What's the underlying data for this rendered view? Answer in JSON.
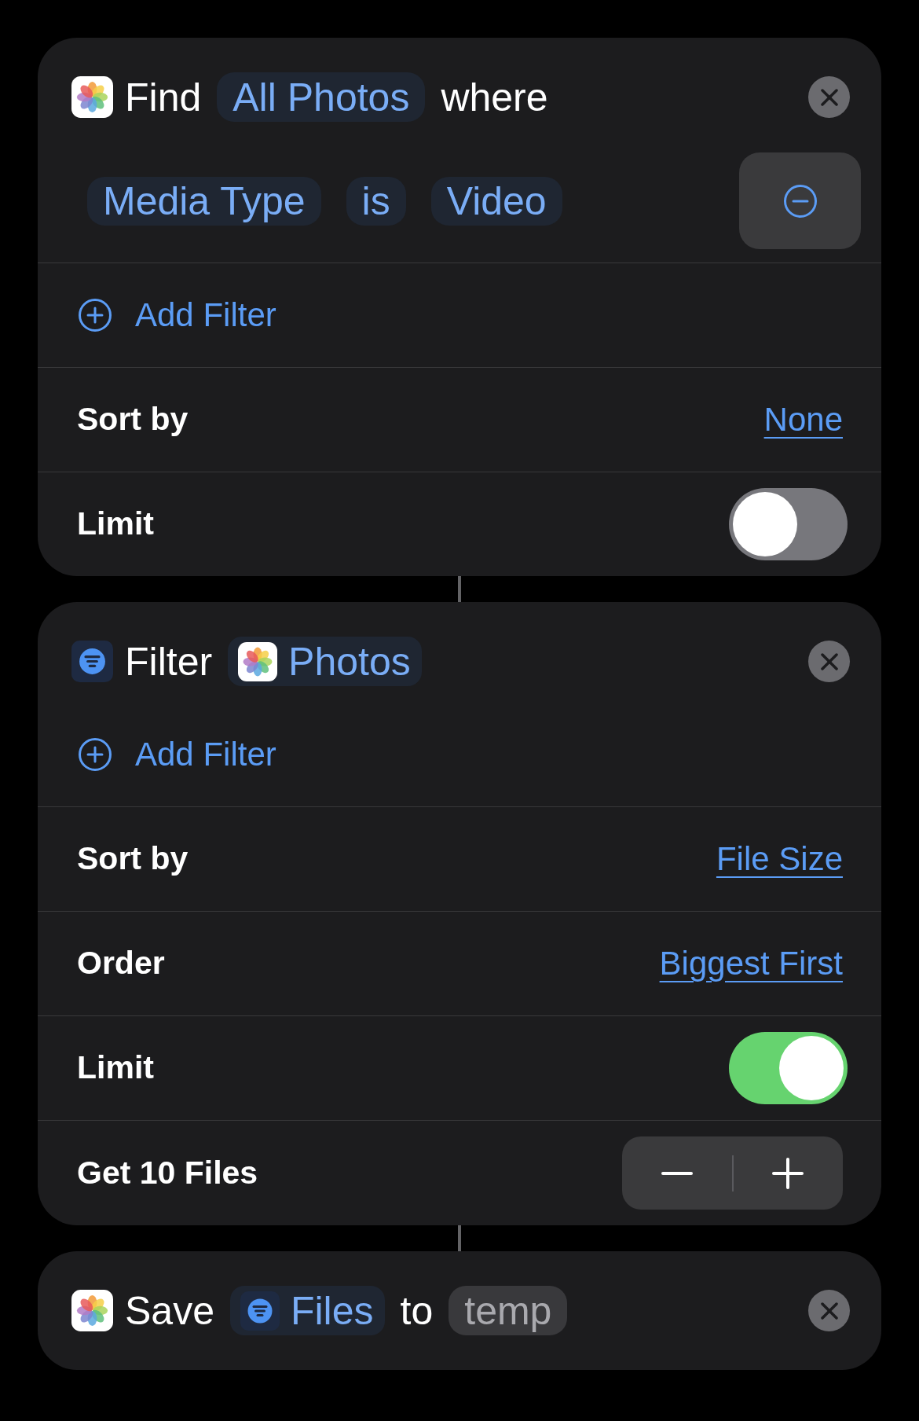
{
  "actions": [
    {
      "kind": "photos",
      "header": [
        {
          "kind": "text",
          "text": "Find"
        },
        {
          "kind": "parameter",
          "text": "All Photos"
        },
        {
          "kind": "text",
          "text": "where"
        }
      ],
      "filters": [
        {
          "tokens": [
            "Media Type",
            "is",
            "Video"
          ]
        }
      ],
      "rows": [
        {
          "kind": "add_filter",
          "label": "Add Filter"
        },
        {
          "kind": "picker",
          "label": "Sort by",
          "value": "None"
        },
        {
          "kind": "toggle",
          "label": "Limit",
          "on": false
        }
      ]
    },
    {
      "kind": "filter",
      "header": [
        {
          "kind": "text",
          "text": "Filter"
        },
        {
          "kind": "photos_variable",
          "text": "Photos"
        }
      ],
      "rows": [
        {
          "kind": "add_filter",
          "label": "Add Filter"
        },
        {
          "kind": "picker",
          "label": "Sort by",
          "value": "File Size"
        },
        {
          "kind": "picker",
          "label": "Order",
          "value": "Biggest First"
        },
        {
          "kind": "toggle",
          "label": "Limit",
          "on": true
        },
        {
          "kind": "stepper",
          "label": "Get 10 Files"
        }
      ]
    },
    {
      "kind": "photos",
      "header": [
        {
          "kind": "text",
          "text": "Save"
        },
        {
          "kind": "filter_variable",
          "text": "Files"
        },
        {
          "kind": "text",
          "text": "to"
        },
        {
          "kind": "muted_parameter",
          "text": "temp"
        }
      ]
    }
  ]
}
